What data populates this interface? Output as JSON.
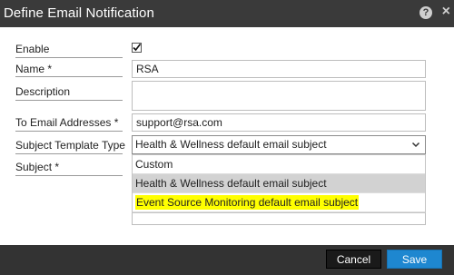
{
  "dialog": {
    "title": "Define Email Notification",
    "help_icon": "?",
    "close_icon": "×"
  },
  "form": {
    "enable_label": "Enable",
    "enable_checked": true,
    "name_label": "Name *",
    "name_value": "RSA",
    "description_label": "Description",
    "description_value": "",
    "to_label": "To Email Addresses *",
    "to_value": "support@rsa.com",
    "subject_template_label": "Subject Template Type",
    "subject_template_value": "Health & Wellness default email subject",
    "subject_label": "Subject *"
  },
  "dropdown": {
    "options": [
      "Custom",
      "Health & Wellness default email subject",
      "Event Source Monitoring default email subject"
    ],
    "selected_index": 1,
    "highlighted_index": 2,
    "highlight_color": "#ffff00"
  },
  "footer": {
    "cancel_label": "Cancel",
    "save_label": "Save",
    "save_color": "#1e87d0"
  }
}
